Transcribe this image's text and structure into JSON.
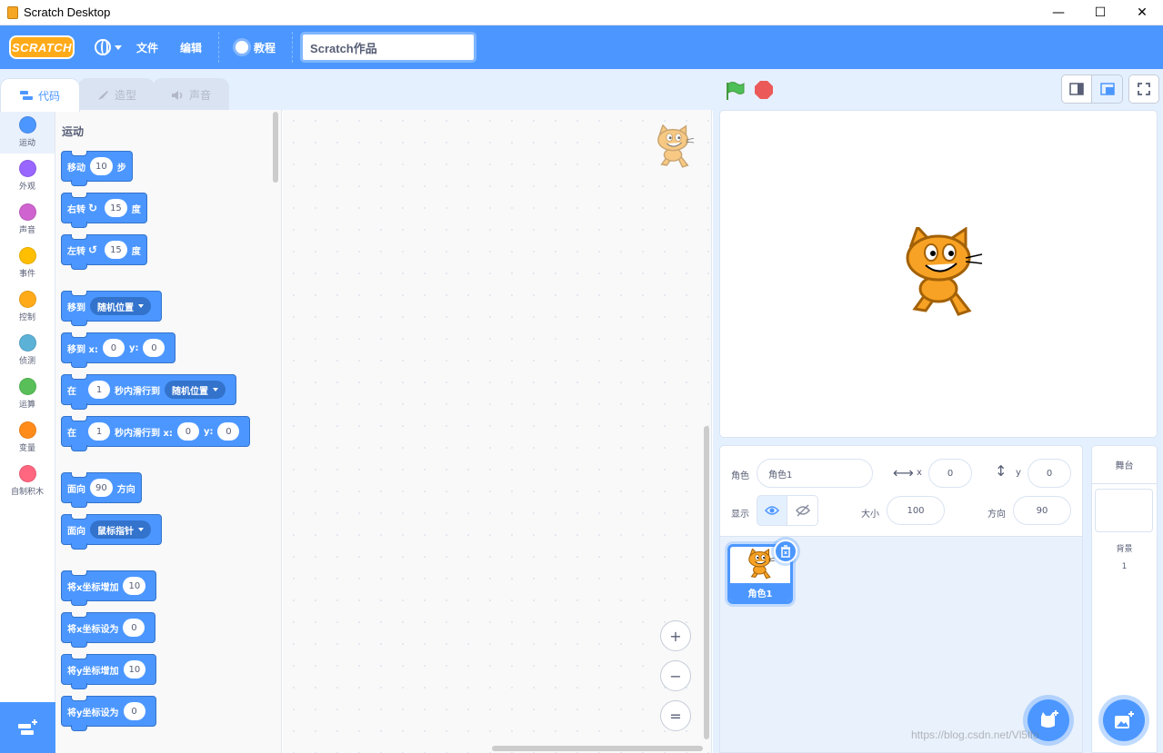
{
  "window": {
    "title": "Scratch Desktop",
    "minimize": "—",
    "maximize": "☐",
    "close": "✕"
  },
  "menubar": {
    "logo": "SCRATCH",
    "file": "文件",
    "edit": "编辑",
    "tutorials": "教程",
    "project_title": "Scratch作品"
  },
  "tabs": {
    "code": "代码",
    "costumes": "造型",
    "sounds": "声音"
  },
  "categories": [
    {
      "label": "运动",
      "color": "#4c97ff"
    },
    {
      "label": "外观",
      "color": "#9966ff"
    },
    {
      "label": "声音",
      "color": "#cf63cf"
    },
    {
      "label": "事件",
      "color": "#ffbf00"
    },
    {
      "label": "控制",
      "color": "#ffab19"
    },
    {
      "label": "侦测",
      "color": "#5cb1d6"
    },
    {
      "label": "运算",
      "color": "#59c059"
    },
    {
      "label": "变量",
      "color": "#ff8c1a"
    },
    {
      "label": "自制积木",
      "color": "#ff6680"
    }
  ],
  "palette": {
    "section_title": "运动",
    "blocks": {
      "move": {
        "pre": "移动",
        "val": "10",
        "post": "步"
      },
      "turn_right": {
        "pre": "右转",
        "val": "15",
        "post": "度"
      },
      "turn_left": {
        "pre": "左转",
        "val": "15",
        "post": "度"
      },
      "goto": {
        "pre": "移到",
        "dd": "随机位置"
      },
      "goto_xy": {
        "pre": "移到 x:",
        "x": "0",
        "ylbl": "y:",
        "y": "0"
      },
      "glide": {
        "pre": "在",
        "val": "1",
        "mid": "秒内滑行到",
        "dd": "随机位置"
      },
      "glide_xy": {
        "pre": "在",
        "val": "1",
        "mid": "秒内滑行到 x:",
        "x": "0",
        "ylbl": "y:",
        "y": "0"
      },
      "point_dir": {
        "pre": "面向",
        "val": "90",
        "post": "方向"
      },
      "point_towards": {
        "pre": "面向",
        "dd": "鼠标指针"
      },
      "change_x": {
        "pre": "将x坐标增加",
        "val": "10"
      },
      "set_x": {
        "pre": "将x坐标设为",
        "val": "0"
      },
      "change_y": {
        "pre": "将y坐标增加",
        "val": "10"
      },
      "set_y": {
        "pre": "将y坐标设为",
        "val": "0"
      }
    }
  },
  "zoom": {
    "in": "+",
    "out": "−",
    "reset": "="
  },
  "sprite_info": {
    "sprite_label": "角色",
    "sprite_name": "角色1",
    "x_label": "x",
    "x": "0",
    "y_label": "y",
    "y": "0",
    "show_label": "显示",
    "size_label": "大小",
    "size": "100",
    "direction_label": "方向",
    "direction": "90"
  },
  "sprites": [
    {
      "name": "角色1"
    }
  ],
  "stage_selector": {
    "title": "舞台",
    "backdrops_label": "背景",
    "backdrops_count": "1"
  },
  "watermark": "https://blog.csdn.net/Vl5lfo",
  "colors": {
    "accent": "#4c97ff",
    "accent_dark": "#3373cc",
    "flag": "#4cbf56",
    "stop": "#ec5959"
  }
}
